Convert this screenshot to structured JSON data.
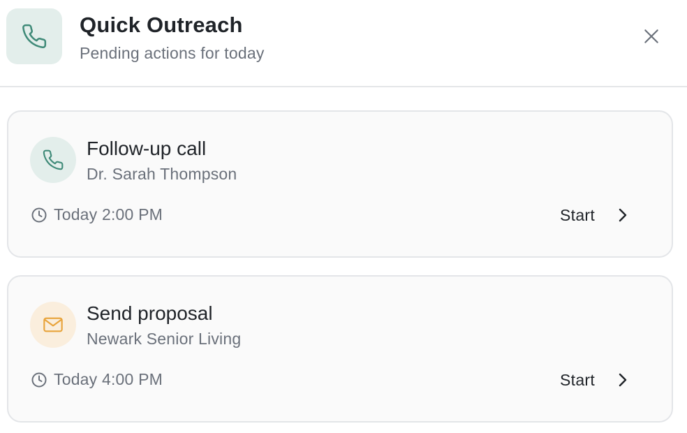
{
  "header": {
    "title": "Quick Outreach",
    "subtitle": "Pending actions for today",
    "icon": "phone-icon",
    "accent_color": "#3f8a78",
    "icon_background": "#e3eeeb"
  },
  "close": {
    "icon": "close-icon"
  },
  "tasks": [
    {
      "title": "Follow-up call",
      "contact": "Dr. Sarah Thompson",
      "time": "Today 2:00 PM",
      "action_label": "Start",
      "icon": "phone-icon",
      "icon_color": "#3f8a78",
      "icon_background": "#e3eeeb"
    },
    {
      "title": "Send proposal",
      "contact": "Newark Senior Living",
      "time": "Today 4:00 PM",
      "action_label": "Start",
      "icon": "mail-icon",
      "icon_color": "#e8a33a",
      "icon_background": "#faeedd"
    }
  ]
}
